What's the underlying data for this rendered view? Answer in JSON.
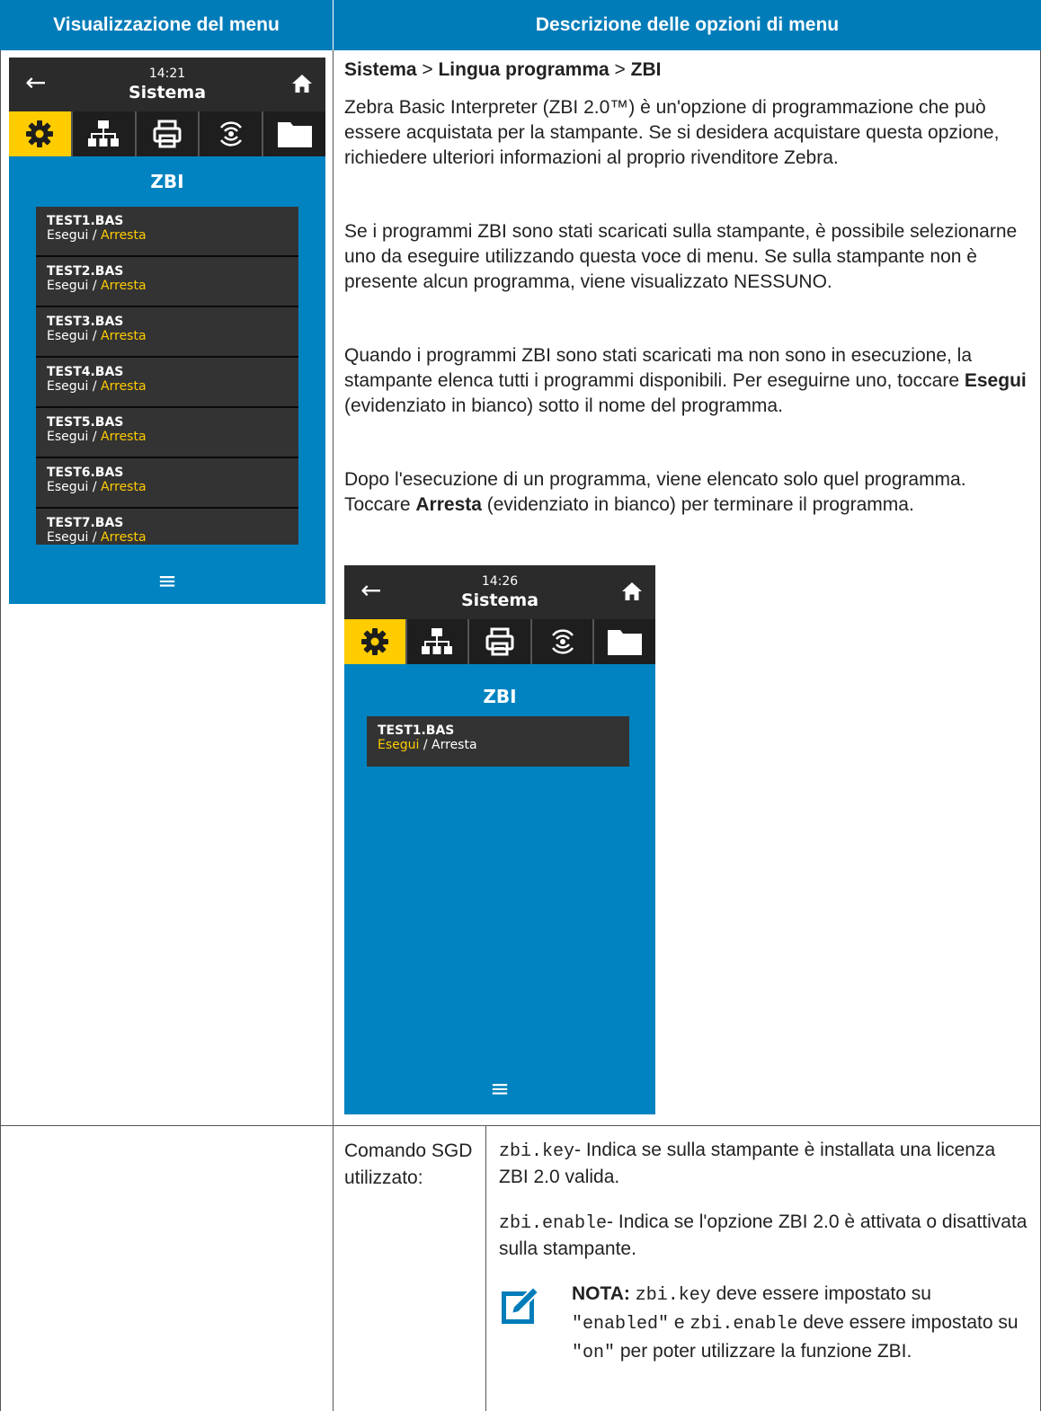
{
  "header": {
    "left": "Visualizzazione del menu",
    "right": "Descrizione delle opzioni di menu"
  },
  "screen1": {
    "time": "14:21",
    "title": "Sistema",
    "heading": "ZBI",
    "items": [
      {
        "name": "TEST1.BAS",
        "run": "Esegui",
        "sep": " / ",
        "stop": "Arresta"
      },
      {
        "name": "TEST2.BAS",
        "run": "Esegui",
        "sep": " / ",
        "stop": "Arresta"
      },
      {
        "name": "TEST3.BAS",
        "run": "Esegui",
        "sep": " / ",
        "stop": "Arresta"
      },
      {
        "name": "TEST4.BAS",
        "run": "Esegui",
        "sep": " / ",
        "stop": "Arresta"
      },
      {
        "name": "TEST5.BAS",
        "run": "Esegui",
        "sep": " / ",
        "stop": "Arresta"
      },
      {
        "name": "TEST6.BAS",
        "run": "Esegui",
        "sep": " / ",
        "stop": "Arresta"
      },
      {
        "name": "TEST7.BAS",
        "run": "Esegui",
        "sep": " / ",
        "stop": "Arresta"
      }
    ],
    "menu_icon": "≡"
  },
  "screen2": {
    "time": "14:26",
    "title": "Sistema",
    "heading": "ZBI",
    "items": [
      {
        "name": "TEST1.BAS",
        "run": "Esegui",
        "sep": " / ",
        "stop": "Arresta"
      }
    ],
    "menu_icon": "≡"
  },
  "breadcrumb": {
    "a": "Sistema",
    "sep1": " > ",
    "b": "Lingua programma",
    "sep2": " > ",
    "c": "ZBI"
  },
  "para1": "Zebra Basic Interpreter (ZBI 2.0™) è un'opzione di programmazione che può essere acquistata per la stampante. Se si desidera acquistare questa opzione, richiedere ulteriori informazioni al proprio rivenditore Zebra.",
  "para2": "Se i programmi ZBI sono stati scaricati sulla stampante, è possibile selezionarne uno da eseguire utilizzando questa voce di menu. Se sulla stampante non è presente alcun programma, viene visualizzato NESSUNO.",
  "para3": {
    "before": "Quando i programmi ZBI sono stati scaricati ma non sono in esecuzione, la stampante elenca tutti i programmi disponibili. Per eseguirne uno, toccare ",
    "bold": "Esegui",
    "after": " (evidenziato in bianco) sotto il nome del programma."
  },
  "para4": {
    "before": "Dopo l'esecuzione di un programma, viene elencato solo quel programma. Toccare ",
    "bold": "Arresta",
    "after": " (evidenziato in bianco) per terminare il programma."
  },
  "sgd": {
    "label": "Comando SGD utilizzato:",
    "cmd1_code": "zbi.key",
    "cmd1_text": "- Indica se sulla stampante è installata una licenza ZBI 2.0 valida.",
    "cmd2_code": "zbi.enable",
    "cmd2_text": "- Indica se l'opzione ZBI 2.0 è attivata o disattivata sulla stampante.",
    "note_label": "NOTA:",
    "note_code1": "zbi.key",
    "note_t1": " deve essere impostato su ",
    "note_code2": "\"enabled\"",
    "note_t2": " e ",
    "note_code3": "zbi.enable",
    "note_t3": " deve essere impostato su ",
    "note_code4": "\"on\"",
    "note_t4": " per poter utilizzare la funzione ZBI."
  },
  "colors": {
    "header_blue": "#007cb9",
    "screen_blue": "#0083c0",
    "highlight_yellow": "#ffcc00"
  }
}
